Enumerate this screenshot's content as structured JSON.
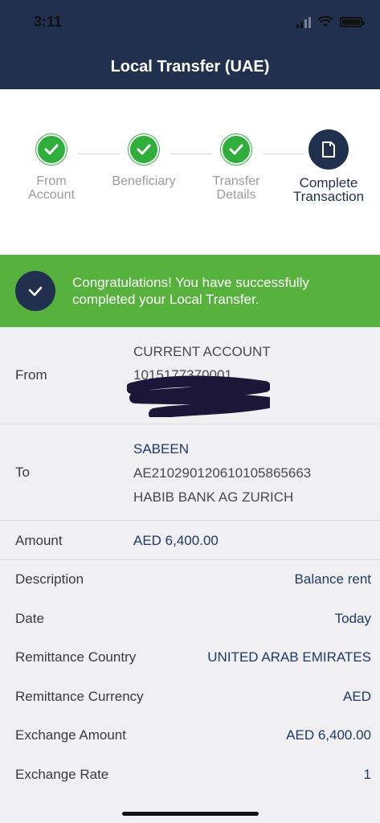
{
  "status_bar": {
    "time": "3:11"
  },
  "header": {
    "title": "Local Transfer (UAE)"
  },
  "steps": [
    {
      "line1": "From",
      "line2": "Account",
      "state": "done"
    },
    {
      "line1": "Beneficiary",
      "line2": "",
      "state": "done"
    },
    {
      "line1": "Transfer",
      "line2": "Details",
      "state": "done"
    },
    {
      "line1": "Complete",
      "line2": "Transaction",
      "state": "current"
    }
  ],
  "banner": {
    "message": "Congratulations! You have successfully completed your Local Transfer."
  },
  "from": {
    "label": "From",
    "account_type": "CURRENT ACCOUNT",
    "account_number": "1015177370001"
  },
  "to": {
    "label": "To",
    "name": "SABEEN",
    "iban": "AE210290120610105865663",
    "bank": "HABIB BANK AG ZURICH"
  },
  "amount": {
    "label": "Amount",
    "value": "AED 6,400.00"
  },
  "fields": [
    {
      "label": "Description",
      "value": "Balance rent"
    },
    {
      "label": "Date",
      "value": "Today"
    },
    {
      "label": "Remittance Country",
      "value": "UNITED ARAB EMIRATES"
    },
    {
      "label": "Remittance Currency",
      "value": "AED"
    },
    {
      "label": "Exchange Amount",
      "value": "AED 6,400.00"
    },
    {
      "label": "Exchange Rate",
      "value": "1"
    }
  ],
  "colors": {
    "header": "#22304f",
    "success": "#56b23d",
    "step_done": "#2fae3b",
    "value_blue": "#1e3a68"
  }
}
